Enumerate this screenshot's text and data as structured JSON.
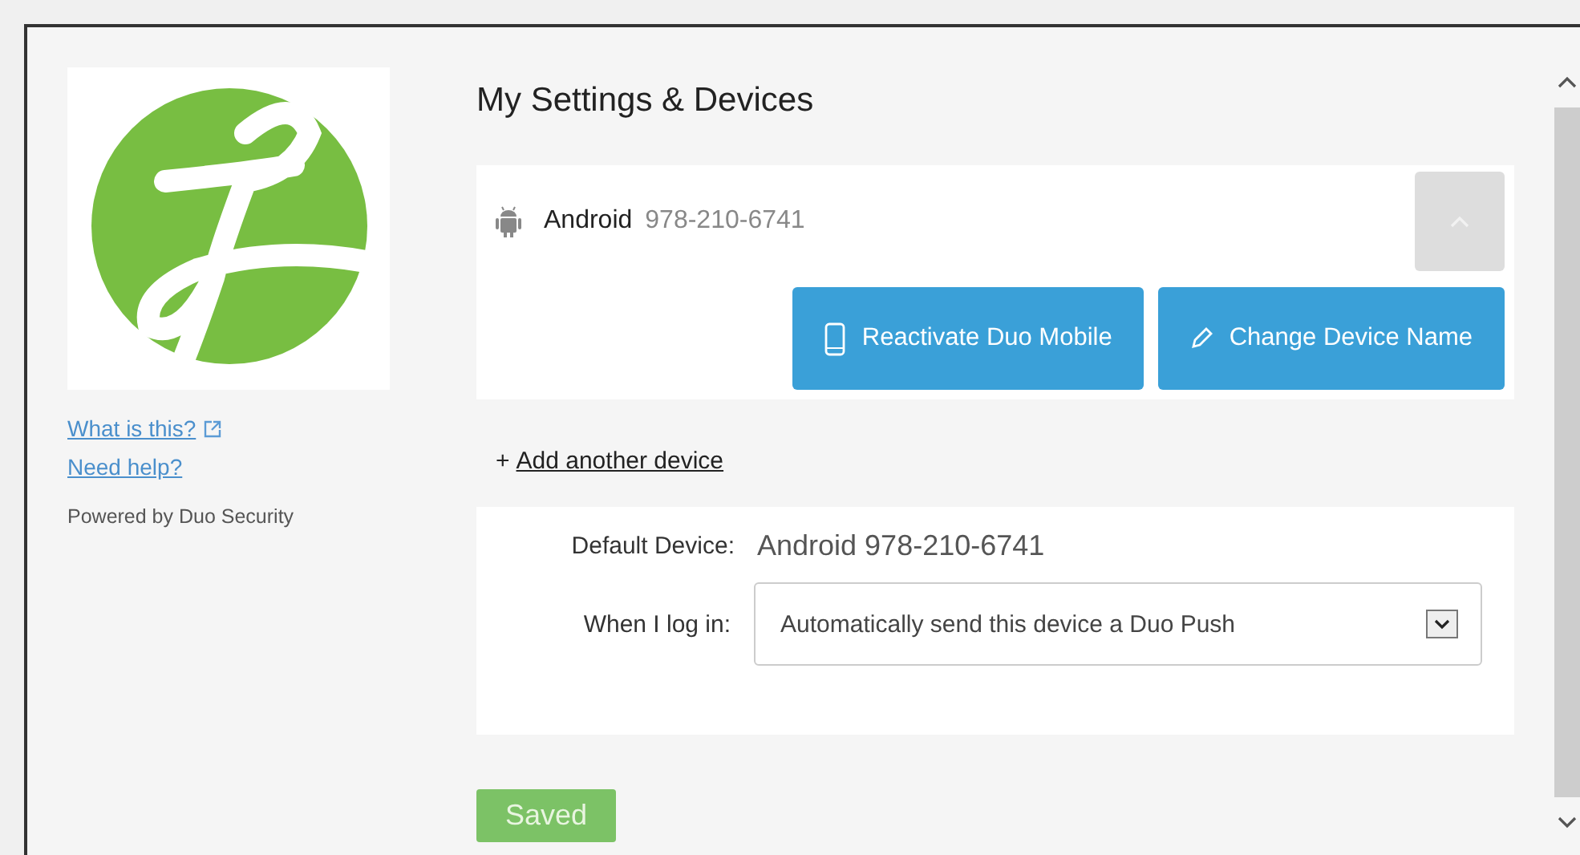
{
  "sidebar": {
    "links": [
      {
        "label": "What is this?",
        "external": true
      },
      {
        "label": "Need help?",
        "external": false
      }
    ],
    "powered_by": "Powered by Duo Security"
  },
  "title": "My Settings & Devices",
  "device": {
    "name": "Android",
    "number": "978-210-6741",
    "expanded": true,
    "actions": [
      {
        "kind": "phone",
        "label": "Reactivate Duo Mobile"
      },
      {
        "kind": "pencil",
        "label": "Change Device Name"
      }
    ]
  },
  "add_device": {
    "prefix": "+",
    "label": "Add another device"
  },
  "default_device": {
    "label": "Default Device:",
    "value": "Android 978-210-6741"
  },
  "login": {
    "label": "When I log in:",
    "value": "Automatically send this device a Duo Push"
  },
  "save_button": {
    "label": "Saved",
    "disabled": true
  }
}
